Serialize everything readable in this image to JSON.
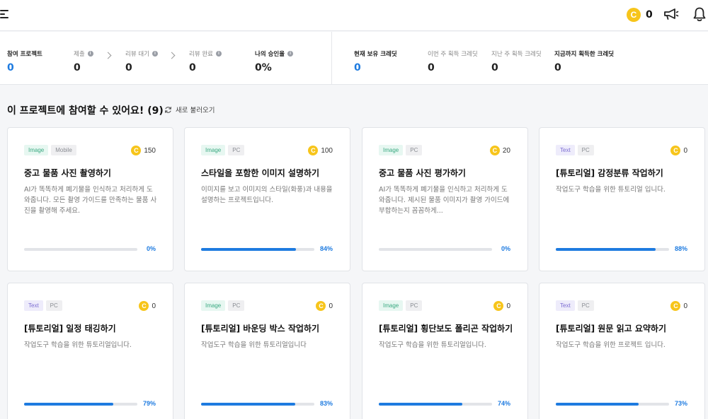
{
  "header": {
    "credit_symbol": "C",
    "credit_count": "0"
  },
  "stats": {
    "participating": {
      "label": "참여 프로젝트",
      "value": "0"
    },
    "submitted": {
      "label": "제출",
      "value": "0"
    },
    "review_waiting": {
      "label": "리뷰 대기",
      "value": "0"
    },
    "review_done": {
      "label": "리뷰 완료",
      "value": "0"
    },
    "approval_rate": {
      "label": "나의 승인율",
      "value": "0%"
    },
    "current_credit": {
      "label": "현재 보유 크레딧",
      "value": "0"
    },
    "this_week_credit": {
      "label": "이번 주 획득 크레딧",
      "value": "0"
    },
    "last_week_credit": {
      "label": "지난 주 획득 크레딧",
      "value": "0"
    },
    "total_credit": {
      "label": "지금까지 획득한 크레딧",
      "value": "0"
    }
  },
  "section": {
    "title": "이 프로젝트에 참여할 수 있어요! (9)",
    "refresh_label": "새로 불러오기"
  },
  "projects": [
    {
      "type": "Image",
      "platform": "Mobile",
      "reward": "150",
      "title": "중고 물품 사진 촬영하기",
      "desc": "AI가 똑똑하게 폐기물을 인식하고 처리하게 도와줍니다. 모든 촬영 가이드를 만족하는 물품 사진을 촬영해 주세요.",
      "progress": 0,
      "progress_label": "0%"
    },
    {
      "type": "Image",
      "platform": "PC",
      "reward": "100",
      "title": "스타일을 포함한 이미지 설명하기",
      "desc": "이미지를 보고 이미지의 스타일(화풍)과 내용을 설명하는 프로젝트입니다.",
      "progress": 84,
      "progress_label": "84%"
    },
    {
      "type": "Image",
      "platform": "PC",
      "reward": "20",
      "title": "중고 물품 사진 평가하기",
      "desc": "AI가 똑똑하게 폐기물을 인식하고 처리하게 도와줍니다. 제시된 물품 이미지가 촬영 가이드에 부합하는지 꼼꼼하게...",
      "progress": 0,
      "progress_label": "0%"
    },
    {
      "type": "Text",
      "platform": "PC",
      "reward": "0",
      "title": "[튜토리얼] 감정분류 작업하기",
      "desc": "작업도구 학습을 위한 튜토리얼 입니다.",
      "progress": 88,
      "progress_label": "88%"
    },
    {
      "type": "Text",
      "platform": "PC",
      "reward": "0",
      "title": "[튜토리얼] 일정 태깅하기",
      "desc": "작업도구 학습을 위한 튜토리얼입니다.",
      "progress": 79,
      "progress_label": "79%"
    },
    {
      "type": "Image",
      "platform": "PC",
      "reward": "0",
      "title": "[튜토리얼] 바운딩 박스 작업하기",
      "desc": "작업도구 학습을 위한 튜토리얼입니다",
      "progress": 83,
      "progress_label": "83%"
    },
    {
      "type": "Image",
      "platform": "PC",
      "reward": "0",
      "title": "[튜토리얼] 횡단보도 폴리곤 작업하기",
      "desc": "작업도구 학습을 위한 튜토리얼입니다.",
      "progress": 74,
      "progress_label": "74%"
    },
    {
      "type": "Text",
      "platform": "PC",
      "reward": "0",
      "title": "[튜토리얼] 원문 읽고 요약하기",
      "desc": "작업도구 학습을 위한 프로젝트 입니다.",
      "progress": 73,
      "progress_label": "73%"
    }
  ],
  "colors": {
    "accent": "#1e7be0",
    "coin": "#f7c51b",
    "tag_image_text": "#3aa981",
    "tag_text_text": "#7a6bd1"
  },
  "icons": [
    "menu-icon",
    "coin-icon",
    "megaphone-icon",
    "bell-icon",
    "info-icon",
    "chevron-right-icon",
    "refresh-icon"
  ]
}
